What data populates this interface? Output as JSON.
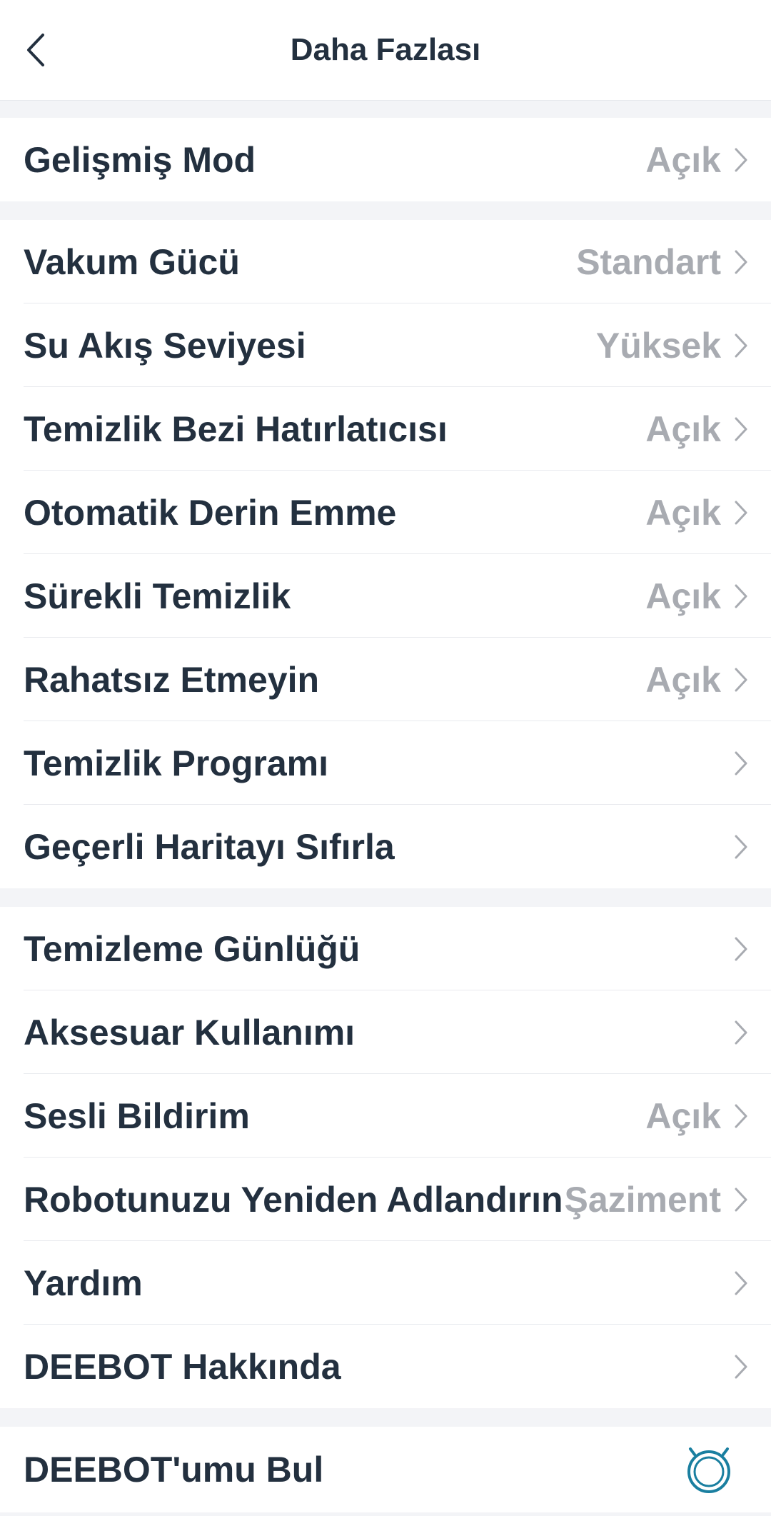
{
  "header": {
    "title": "Daha Fazlası"
  },
  "sections": [
    [
      {
        "label": "Gelişmiş Mod",
        "value": "Açık"
      }
    ],
    [
      {
        "label": "Vakum Gücü",
        "value": "Standart"
      },
      {
        "label": "Su Akış Seviyesi",
        "value": "Yüksek"
      },
      {
        "label": "Temizlik Bezi Hatırlatıcısı",
        "value": "Açık"
      },
      {
        "label": "Otomatik Derin Emme",
        "value": "Açık"
      },
      {
        "label": "Sürekli Temizlik",
        "value": "Açık"
      },
      {
        "label": "Rahatsız Etmeyin",
        "value": "Açık"
      },
      {
        "label": "Temizlik Programı",
        "value": ""
      },
      {
        "label": "Geçerli Haritayı Sıfırla",
        "value": ""
      }
    ],
    [
      {
        "label": "Temizleme Günlüğü",
        "value": ""
      },
      {
        "label": "Aksesuar Kullanımı",
        "value": ""
      },
      {
        "label": "Sesli Bildirim",
        "value": "Açık"
      },
      {
        "label": "Robotunuzu Yeniden Adlandırın",
        "value": "Şaziment"
      },
      {
        "label": "Yardım",
        "value": ""
      },
      {
        "label": "DEEBOT Hakkında",
        "value": ""
      }
    ]
  ],
  "find": {
    "label": "DEEBOT'umu Bul",
    "icon": "robot-icon"
  },
  "colors": {
    "text": "#23303f",
    "value": "#a8abb1",
    "background": "#f3f4f7",
    "accent": "#1a7fa0"
  }
}
